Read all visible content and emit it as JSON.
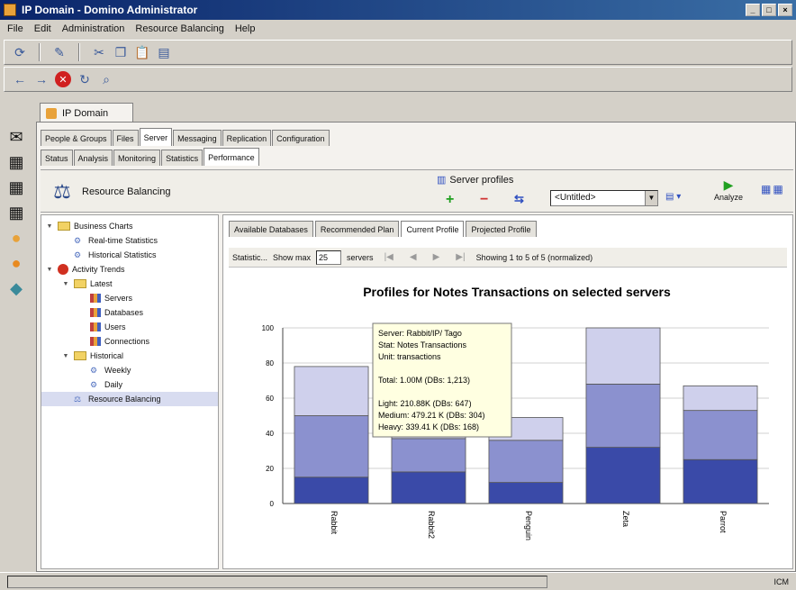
{
  "window": {
    "title": "IP Domain - Domino Administrator",
    "buttons": [
      "_",
      "□",
      "×"
    ]
  },
  "menu": [
    "File",
    "Edit",
    "Administration",
    "Resource Balancing",
    "Help"
  ],
  "doc_tab": "IP Domain",
  "tabs_row1": [
    "People & Groups",
    "Files",
    "Server",
    "Messaging",
    "Replication",
    "Configuration"
  ],
  "tabs_row2": [
    "Status",
    "Analysis",
    "Monitoring",
    "Statistics",
    "Performance"
  ],
  "header": {
    "title": "Resource Balancing",
    "server_profiles_label": "Server profiles",
    "select_value": "<Untitled>",
    "analyze_label": "Analyze"
  },
  "tree": [
    {
      "label": "Business Charts",
      "level": 0,
      "icon": "folder-icon",
      "expanded": true
    },
    {
      "label": "Real-time Statistics",
      "level": 1,
      "icon": "stats-icon"
    },
    {
      "label": "Historical Statistics",
      "level": 1,
      "icon": "stats-icon"
    },
    {
      "label": "Activity Trends",
      "level": 0,
      "icon": "activity-icon",
      "expanded": true
    },
    {
      "label": "Latest",
      "level": 1,
      "icon": "folder-icon",
      "expanded": true
    },
    {
      "label": "Servers",
      "level": 2,
      "icon": "chart-icon"
    },
    {
      "label": "Databases",
      "level": 2,
      "icon": "chart-icon"
    },
    {
      "label": "Users",
      "level": 2,
      "icon": "chart-icon"
    },
    {
      "label": "Connections",
      "level": 2,
      "icon": "chart-icon"
    },
    {
      "label": "Historical",
      "level": 1,
      "icon": "folder-icon",
      "expanded": true
    },
    {
      "label": "Weekly",
      "level": 2,
      "icon": "stats-icon"
    },
    {
      "label": "Daily",
      "level": 2,
      "icon": "stats-icon"
    },
    {
      "label": "Resource Balancing",
      "level": 1,
      "icon": "balance-icon",
      "selected": true
    }
  ],
  "sub_tabs": [
    "Available Databases",
    "Recommended Plan",
    "Current Profile",
    "Projected Profile"
  ],
  "navbar": {
    "label_left": "Statistic...",
    "show_label": "Show max",
    "show_value": "25",
    "units": "servers",
    "showing": "Showing 1 to 5 of 5 (normalized)"
  },
  "tooltip": [
    "Server: Rabbit/IP/ Tago",
    "Stat: Notes Transactions",
    "Unit: transactions",
    "",
    "Total: 1.00M (DBs: 1,213)",
    "",
    "Light: 210.88K (DBs: 647)",
    "Medium: 479.21 K (DBs: 304)",
    "Heavy: 339.41 K (DBs: 168)"
  ],
  "status_bar": {
    "left": "",
    "right": "ICM"
  },
  "chart_data": {
    "type": "bar",
    "stacked": true,
    "title": "Profiles for Notes Transactions on selected servers",
    "categories": [
      "Rabbit",
      "Rabbit2",
      "Penguin",
      "Zeta",
      "Parrot"
    ],
    "ylim": [
      0,
      100
    ],
    "yticks": [
      "0",
      "20",
      "40",
      "60",
      "80",
      "100"
    ],
    "series": [
      {
        "values": [
          15,
          18,
          12,
          32,
          25
        ]
      },
      {
        "values": [
          35,
          19,
          24,
          36,
          28
        ]
      },
      {
        "values": [
          28,
          21,
          13,
          32,
          14
        ]
      }
    ],
    "colors": [
      "#3a4aa8",
      "#8b91cf",
      "#cfd0ec"
    ],
    "grid": true
  }
}
